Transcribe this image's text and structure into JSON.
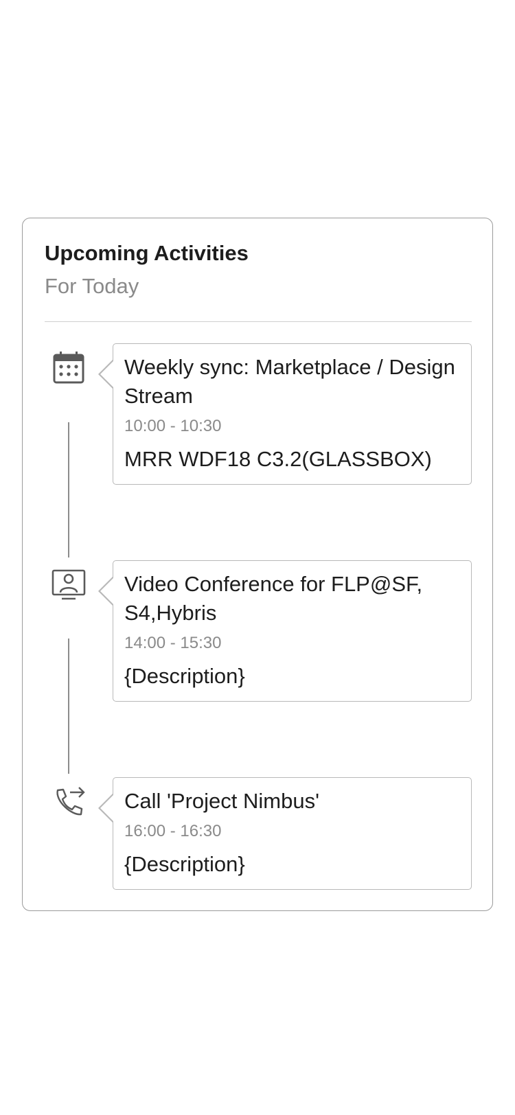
{
  "card": {
    "title": "Upcoming Activities",
    "subtitle": "For Today"
  },
  "activities": [
    {
      "icon": "calendar-icon",
      "title": "Weekly sync: Marketplace / Design Stream",
      "time": "10:00 - 10:30",
      "description": "MRR WDF18 C3.2(GLASSBOX)"
    },
    {
      "icon": "video-conference-icon",
      "title": "Video Conference for FLP@SF, S4,Hybris",
      "time": "14:00 - 15:30",
      "description": "{Description}"
    },
    {
      "icon": "outgoing-call-icon",
      "title": "Call 'Project Nimbus'",
      "time": "16:00 - 16:30",
      "description": "{Description}"
    }
  ],
  "colors": {
    "title_text": "#1d1d1d",
    "secondary_text": "#8a8a8a",
    "border": "#b8b8b8",
    "timeline": "#8c8c8c",
    "icon": "#5a5a5a"
  }
}
